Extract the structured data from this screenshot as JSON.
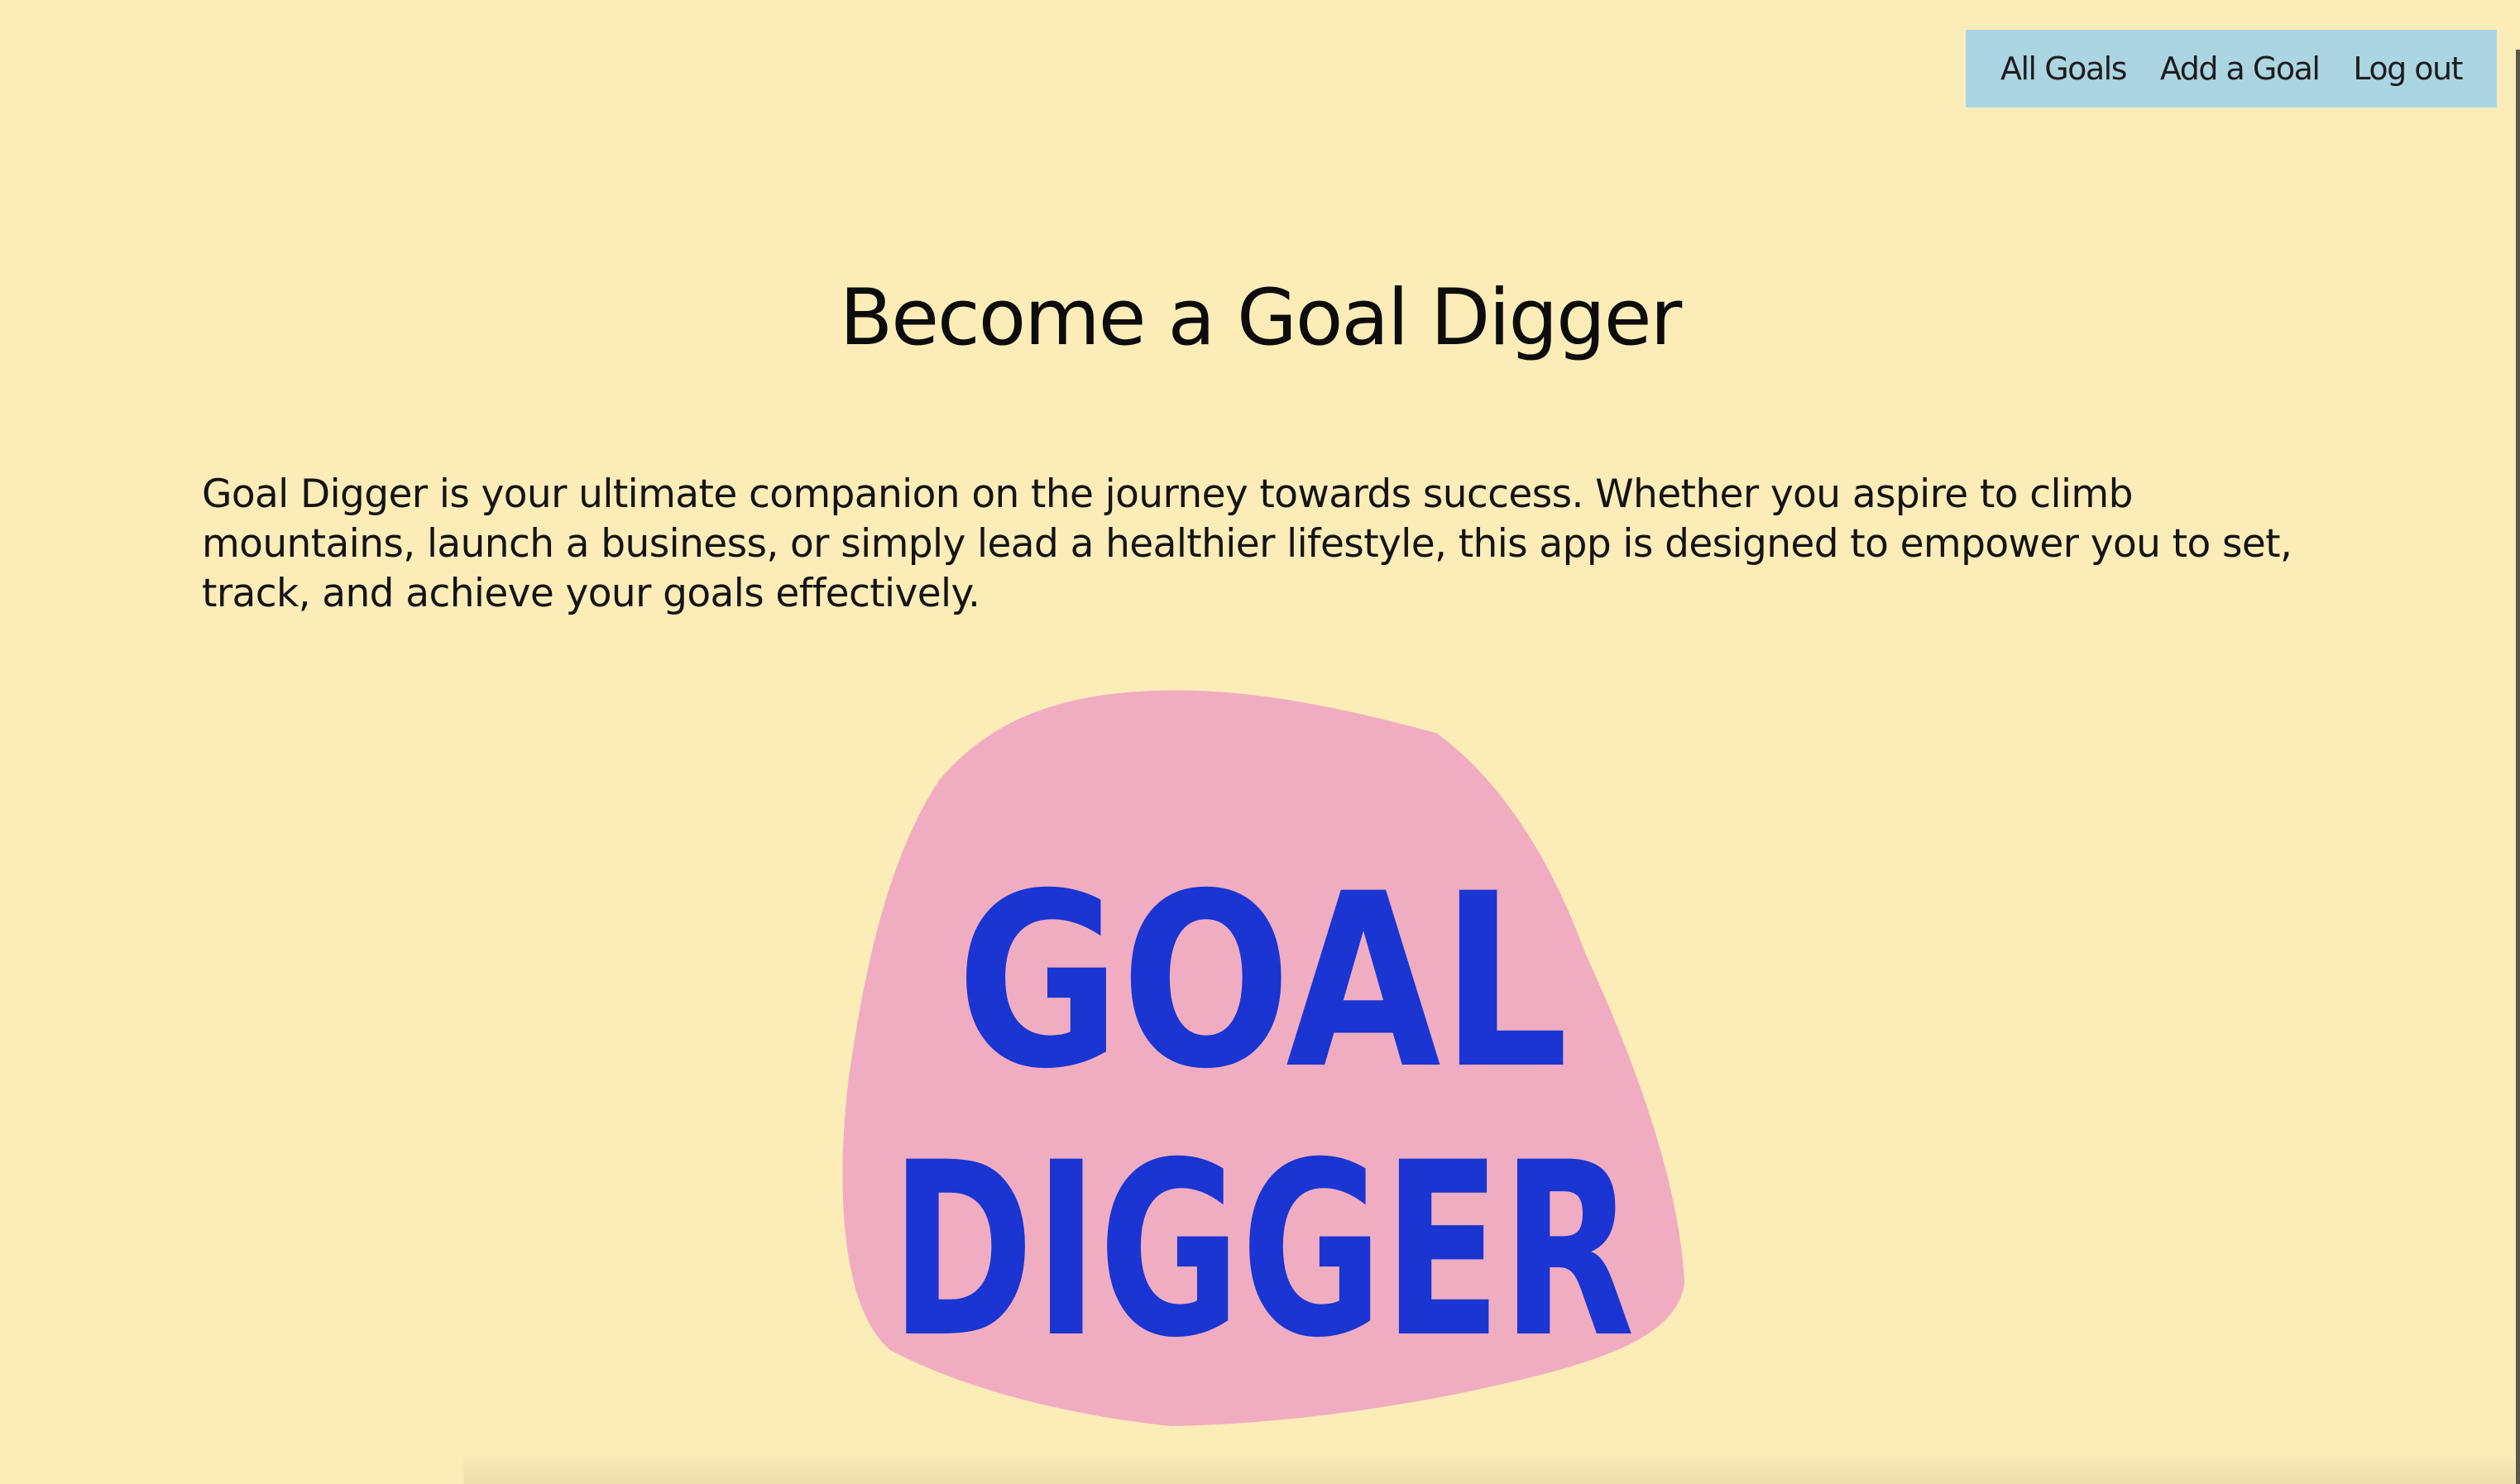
{
  "nav": {
    "all_goals": "All Goals",
    "add_goal": "Add a Goal",
    "log_out": "Log out"
  },
  "hero": {
    "title": "Become a Goal Digger",
    "intro": "Goal Digger is your ultimate companion on the journey towards success. Whether you aspire to climb mountains, launch a business, or simply lead a healthier lifestyle, this app is designed to empower you to set, track, and achieve your goals effectively."
  },
  "logo": {
    "line1": "GOAL",
    "line2": "DIGGER"
  },
  "colors": {
    "page_background": "#fbecb8",
    "nav_background": "#acd5e2",
    "logo_blob": "#f0adc1",
    "logo_text": "#1a35d2"
  }
}
